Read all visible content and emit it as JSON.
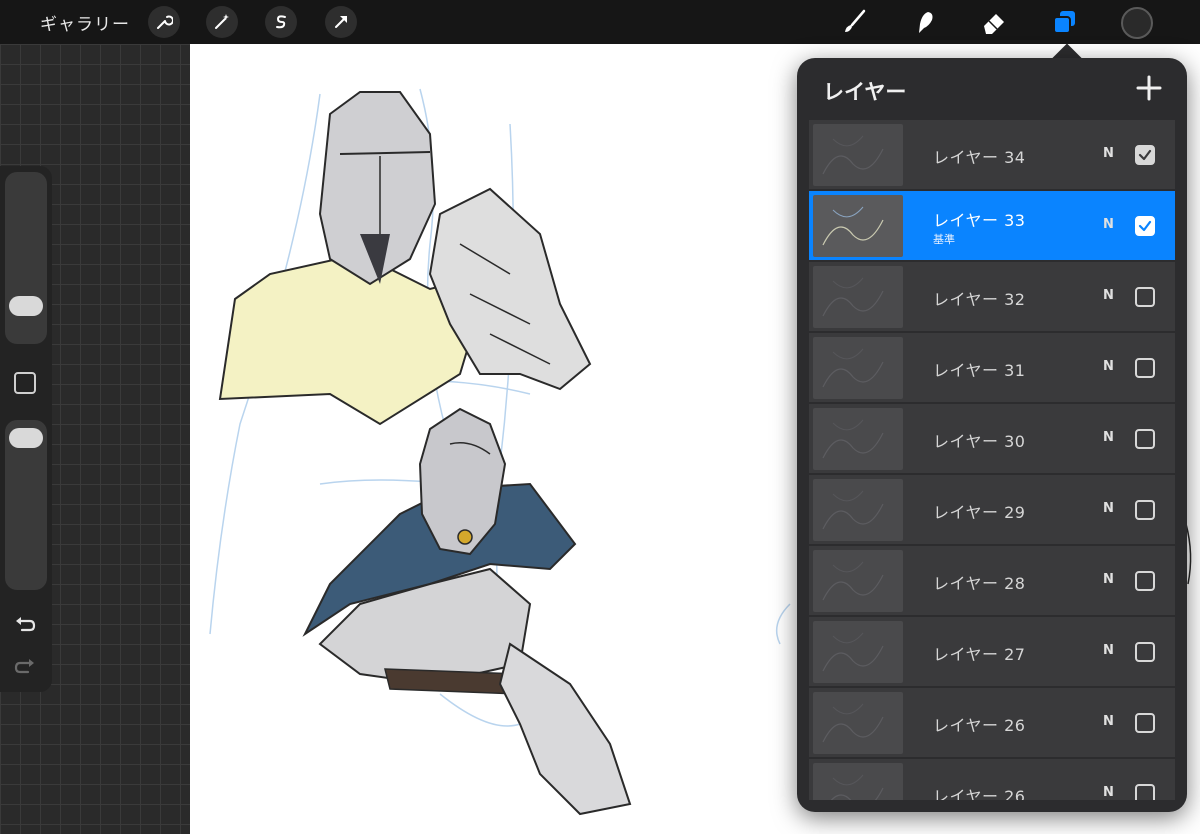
{
  "toolbar": {
    "gallery_label": "ギャラリー",
    "left_tools": [
      "wrench-icon",
      "magic-wand-icon",
      "selection-s-icon",
      "transform-arrow-icon"
    ],
    "right_tools": [
      "brush-icon",
      "smudge-icon",
      "eraser-icon",
      "layers-icon"
    ],
    "current_color": "#2a2a2a",
    "active_color": "#0a84ff"
  },
  "sidebar": {
    "brush_size_level": 0.77,
    "opacity_level": 0.05
  },
  "layers_panel": {
    "title": "レイヤー",
    "add_icon": "plus-icon",
    "layers": [
      {
        "name": "レイヤー 34",
        "sub": "",
        "blend": "N",
        "visible": true,
        "active": false
      },
      {
        "name": "レイヤー 33",
        "sub": "基準",
        "blend": "N",
        "visible": true,
        "active": true
      },
      {
        "name": "レイヤー 32",
        "sub": "",
        "blend": "N",
        "visible": false,
        "active": false
      },
      {
        "name": "レイヤー 31",
        "sub": "",
        "blend": "N",
        "visible": false,
        "active": false
      },
      {
        "name": "レイヤー 30",
        "sub": "",
        "blend": "N",
        "visible": false,
        "active": false
      },
      {
        "name": "レイヤー 29",
        "sub": "",
        "blend": "N",
        "visible": false,
        "active": false
      },
      {
        "name": "レイヤー 28",
        "sub": "",
        "blend": "N",
        "visible": false,
        "active": false
      },
      {
        "name": "レイヤー 27",
        "sub": "",
        "blend": "N",
        "visible": false,
        "active": false
      },
      {
        "name": "レイヤー 26",
        "sub": "",
        "blend": "N",
        "visible": false,
        "active": false
      },
      {
        "name": "レイヤー 26",
        "sub": "",
        "blend": "N",
        "visible": false,
        "active": false
      }
    ]
  }
}
